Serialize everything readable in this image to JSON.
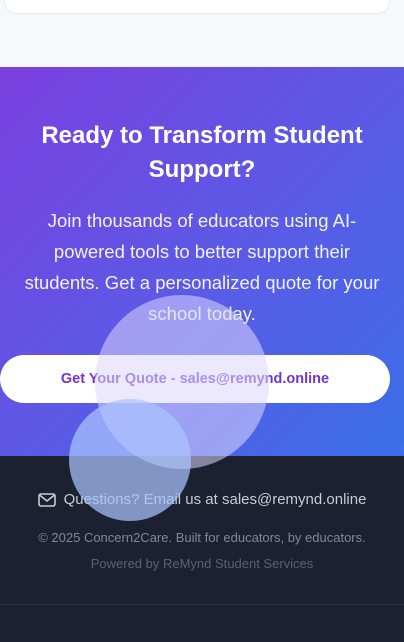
{
  "cta": {
    "heading": "Ready to Transform Student Support?",
    "body": "Join thousands of educators using AI-powered tools to better support their students. Get a personalized quote for your school today.",
    "button_label": "Get Your Quote - sales@remynd.online"
  },
  "footer": {
    "contact_text": "Questions? Email us at sales@remynd.online",
    "copyright": "© 2025 Concern2Care. Built for educators, by educators.",
    "powered_by": "Powered by ReMynd Student Services"
  },
  "icons": {
    "contact": "mail-icon"
  },
  "colors": {
    "gradient_start": "#7b3fe0",
    "gradient_end": "#3a6ee8",
    "button_text": "#7134d6",
    "footer_bg": "#1b2130"
  }
}
